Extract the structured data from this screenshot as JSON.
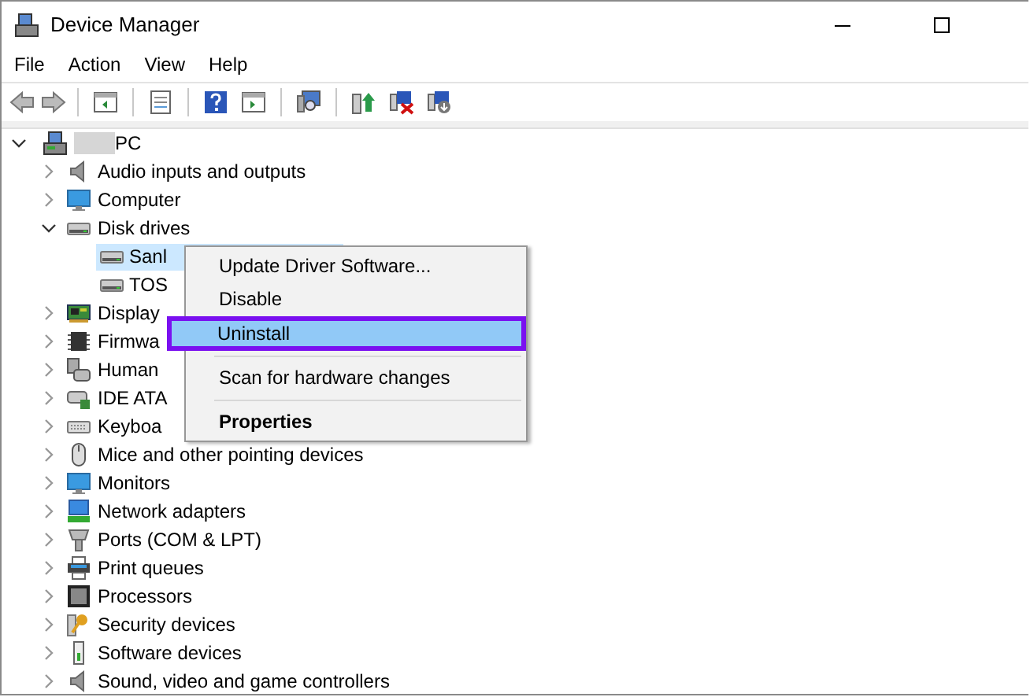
{
  "window": {
    "title": "Device Manager"
  },
  "menu_bar": [
    "File",
    "Action",
    "View",
    "Help"
  ],
  "tree": {
    "label": "PC",
    "redacted": true,
    "expanded": true,
    "children": [
      {
        "label": "Audio inputs and outputs",
        "expanded": false
      },
      {
        "label": "Computer",
        "expanded": false
      },
      {
        "label": "Disk drives",
        "expanded": true,
        "children": [
          {
            "label": "Sanl",
            "selected": true
          },
          {
            "label": "TOS",
            "selected": false
          }
        ]
      },
      {
        "label": "Display",
        "expanded": false
      },
      {
        "label": "Firmwa",
        "expanded": false
      },
      {
        "label": "Human",
        "expanded": false
      },
      {
        "label": "IDE ATA",
        "expanded": false
      },
      {
        "label": "Keyboa",
        "expanded": false
      },
      {
        "label": "Mice and other pointing devices",
        "expanded": false
      },
      {
        "label": "Monitors",
        "expanded": false
      },
      {
        "label": "Network adapters",
        "expanded": false
      },
      {
        "label": "Ports (COM & LPT)",
        "expanded": false
      },
      {
        "label": "Print queues",
        "expanded": false
      },
      {
        "label": "Processors",
        "expanded": false
      },
      {
        "label": "Security devices",
        "expanded": false
      },
      {
        "label": "Software devices",
        "expanded": false
      },
      {
        "label": "Sound, video and game controllers",
        "expanded": false
      }
    ]
  },
  "context_menu": {
    "items": [
      {
        "kind": "item",
        "label": "Update Driver Software...",
        "selected": false,
        "default": false
      },
      {
        "kind": "item",
        "label": "Disable",
        "selected": false,
        "default": false
      },
      {
        "kind": "item",
        "label": "Uninstall",
        "selected": true,
        "default": false
      },
      {
        "kind": "separator"
      },
      {
        "kind": "item",
        "label": "Scan for hardware changes",
        "selected": false,
        "default": false
      },
      {
        "kind": "separator"
      },
      {
        "kind": "item",
        "label": "Properties",
        "selected": false,
        "default": true
      }
    ]
  }
}
